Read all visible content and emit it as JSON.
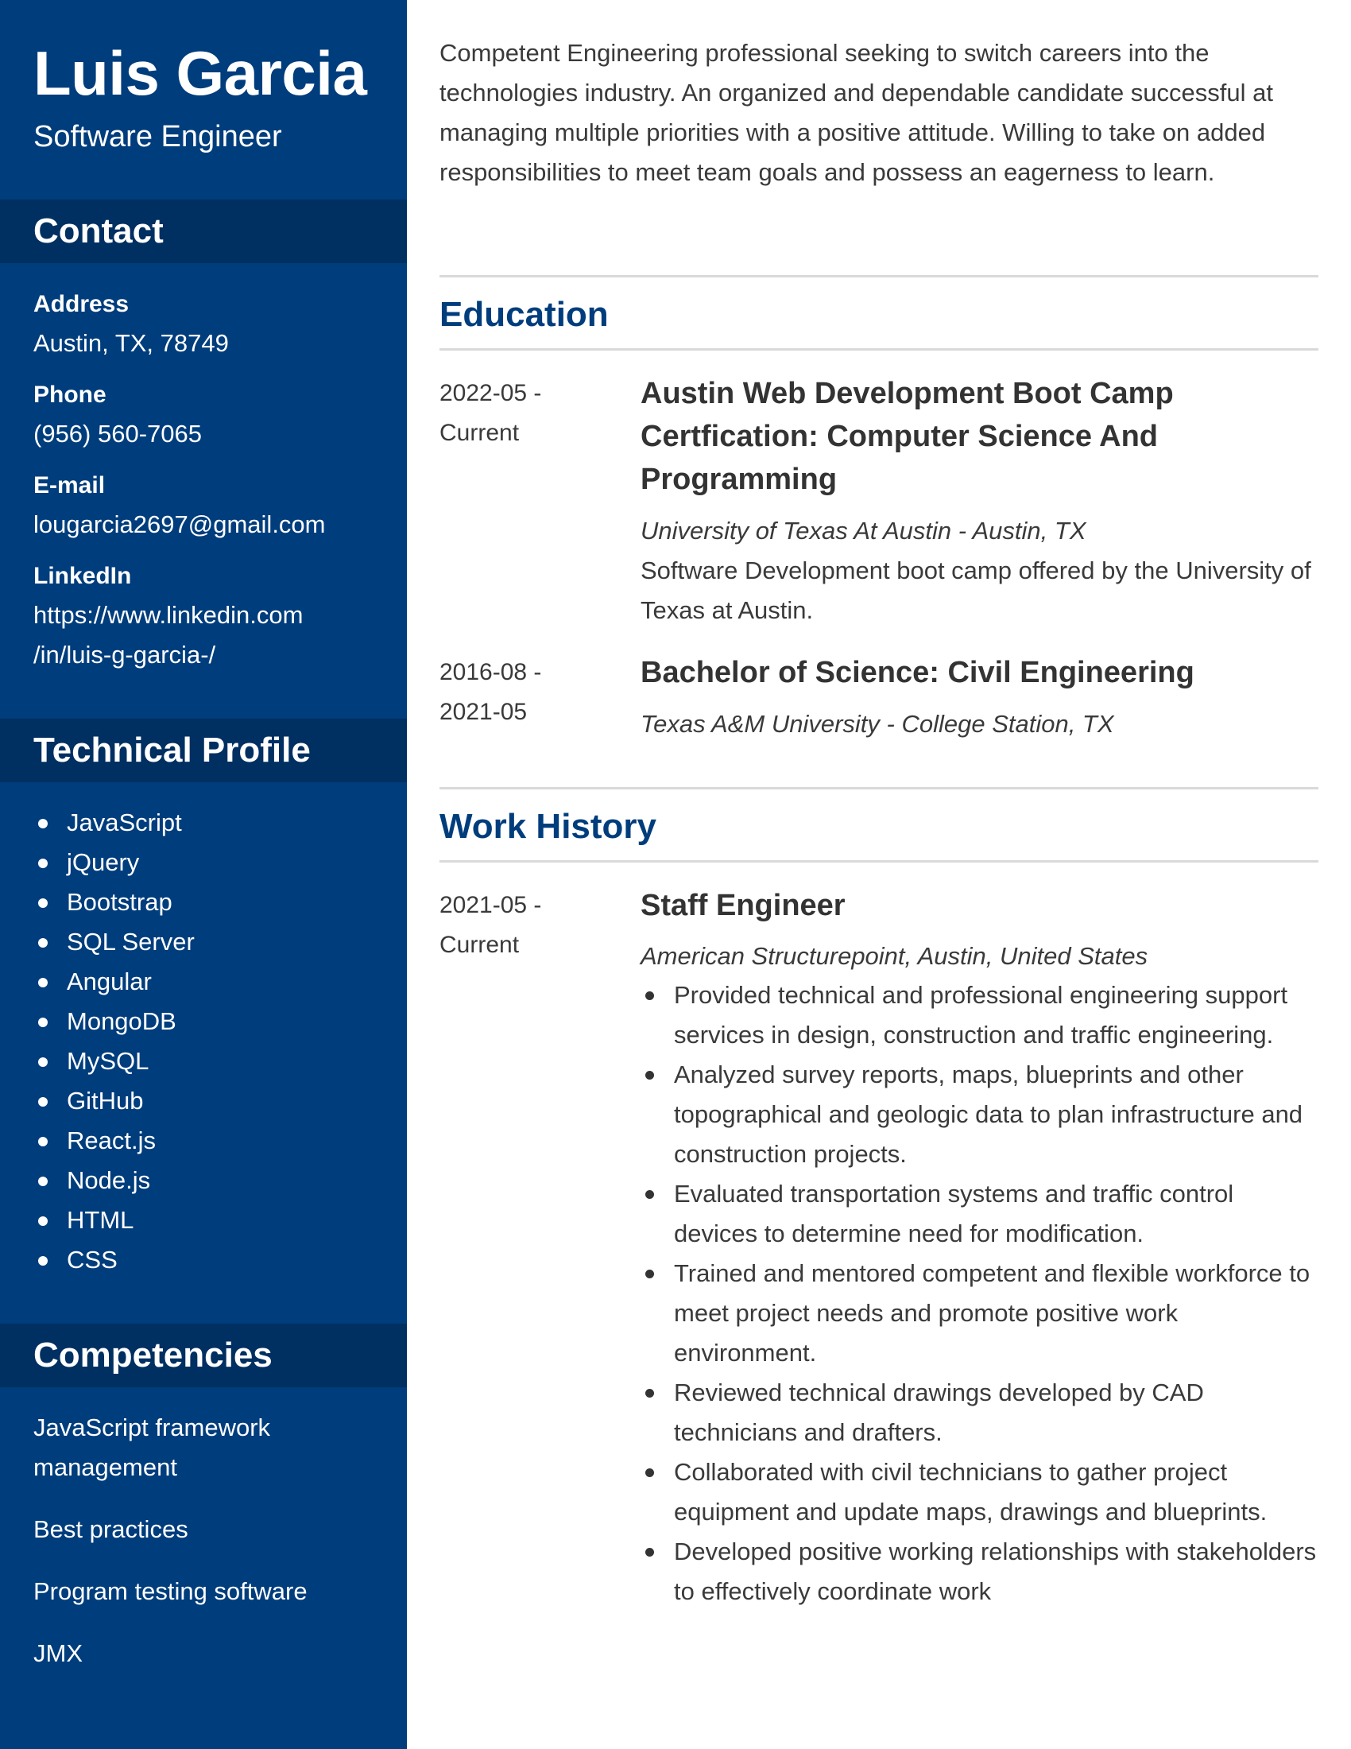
{
  "header": {
    "name": "Luis Garcia",
    "role": "Software Engineer"
  },
  "contact": {
    "heading": "Contact",
    "address_label": "Address",
    "address": "Austin, TX, 78749",
    "phone_label": "Phone",
    "phone": "(956) 560-7065",
    "email_label": "E-mail",
    "email": "lougarcia2697@gmail.com",
    "linkedin_label": "LinkedIn",
    "linkedin_line1": "https://www.linkedin.com",
    "linkedin_line2": "/in/luis-g-garcia-/"
  },
  "technical_profile": {
    "heading": "Technical Profile",
    "items": [
      "JavaScript",
      "jQuery",
      "Bootstrap",
      "SQL Server",
      "Angular",
      "MongoDB",
      "MySQL",
      "GitHub",
      "React.js",
      "Node.js",
      "HTML",
      "CSS"
    ]
  },
  "competencies": {
    "heading": "Competencies",
    "items": [
      "JavaScript framework management",
      "Best practices",
      "Program testing software",
      "JMX"
    ]
  },
  "summary": "Competent Engineering professional seeking to switch careers into the technologies industry. An organized and dependable candidate successful at managing multiple priorities with a positive attitude. Willing to take on added responsibilities to meet team goals and possess an eagerness to learn.",
  "education": {
    "heading": "Education",
    "entries": [
      {
        "date_start": "2022-05 -",
        "date_end": "Current",
        "title": "Austin Web Development Boot Camp Certfication: Computer Science And Programming",
        "institution": "University of Texas At Austin - Austin, TX",
        "description": "Software Development boot camp offered by the University of Texas at Austin."
      },
      {
        "date_start": "2016-08 -",
        "date_end": "2021-05",
        "title": "Bachelor of Science: Civil Engineering",
        "institution": "Texas A&M University - College Station, TX"
      }
    ]
  },
  "work_history": {
    "heading": "Work History",
    "entries": [
      {
        "date_start": "2021-05 -",
        "date_end": "Current",
        "title": "Staff Engineer",
        "company": "American Structurepoint, Austin, United States",
        "bullets": [
          "Provided technical and professional engineering support services in design, construction and traffic engineering.",
          "Analyzed survey reports, maps, blueprints and other topographical and geologic data to plan infrastructure and construction projects.",
          "Evaluated transportation systems and traffic control devices to determine need for modification.",
          "Trained and mentored competent and flexible workforce to meet project needs and promote positive work environment.",
          "Reviewed technical drawings developed by CAD technicians and drafters.",
          "Collaborated with civil technicians to gather project equipment and update maps, drawings and blueprints.",
          "Developed positive working relationships with stakeholders to effectively coordinate work"
        ]
      }
    ]
  }
}
